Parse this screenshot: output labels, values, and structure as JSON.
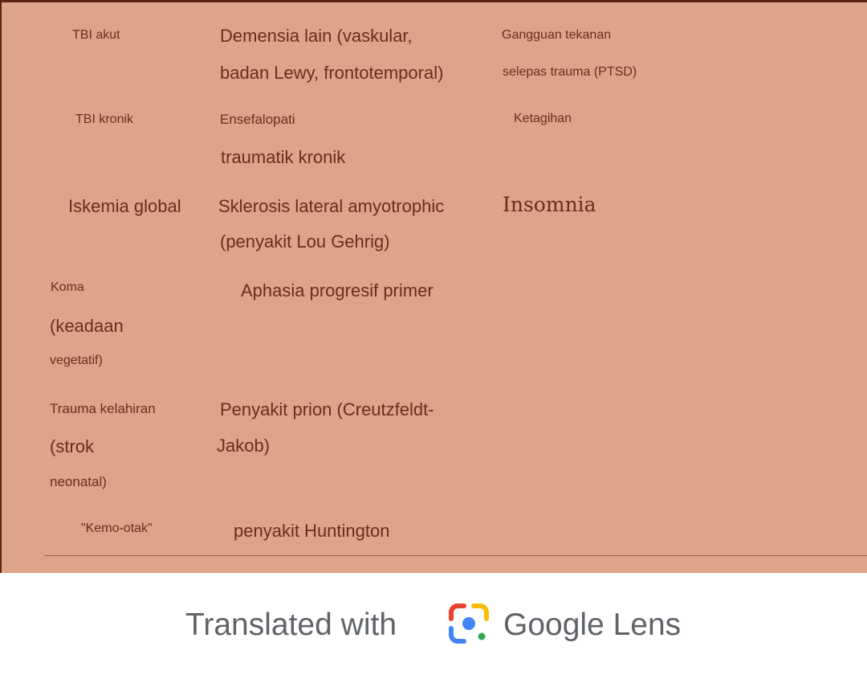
{
  "columns": {
    "left": [
      "TBI akut",
      "TBI kronik",
      "Iskemia global",
      "Koma",
      "(keadaan",
      "vegetatif)",
      "Trauma kelahiran",
      "(strok",
      "neonatal)",
      "\"Kemo-otak\""
    ],
    "middle": [
      "Demensia lain (vaskular,",
      "badan Lewy, frontotemporal)",
      "Ensefalopati",
      "traumatik kronik",
      "Sklerosis lateral amyotrophic",
      "(penyakit Lou Gehrig)",
      "Aphasia progresif primer",
      "Penyakit prion (Creutzfeldt-",
      "Jakob)",
      "penyakit Huntington"
    ],
    "right": [
      "Gangguan tekanan",
      "selepas trauma (PTSD)",
      "Ketagihan",
      "Insomnia"
    ]
  },
  "footer": {
    "prefix": "Translated with",
    "brand": "Google Lens",
    "icon": "google-lens-icon"
  },
  "colors": {
    "page_bg": "#dea48a",
    "text": "#6b2d1c",
    "footer_text": "#5f6368"
  }
}
